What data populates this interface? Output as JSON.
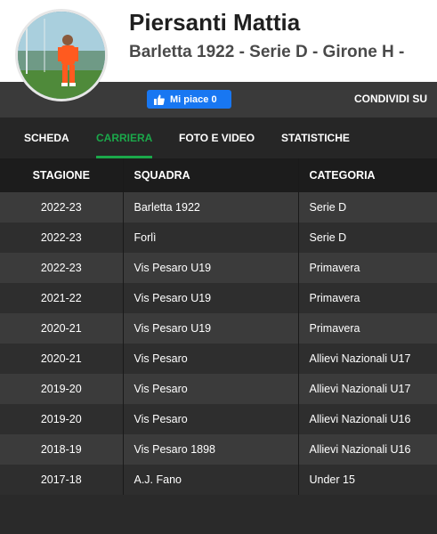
{
  "player": {
    "name": "Piersanti Mattia",
    "subtitle": "Barletta 1922 - Serie D - Girone H -"
  },
  "social": {
    "like_label": "Mi piace 0",
    "share_label": "CONDIVIDI SU",
    "like_color": "#1877f2"
  },
  "tabs": [
    {
      "label": "SCHEDA",
      "active": false
    },
    {
      "label": "CARRIERA",
      "active": true
    },
    {
      "label": "FOTO E VIDEO",
      "active": false
    },
    {
      "label": "STATISTICHE",
      "active": false
    }
  ],
  "accent_color": "#1ba84a",
  "career": {
    "headers": [
      "STAGIONE",
      "SQUADRA",
      "CATEGORIA"
    ],
    "rows": [
      [
        "2022-23",
        "Barletta 1922",
        "Serie D"
      ],
      [
        "2022-23",
        "Forlì",
        "Serie D"
      ],
      [
        "2022-23",
        "Vis Pesaro U19",
        "Primavera"
      ],
      [
        "2021-22",
        "Vis Pesaro U19",
        "Primavera"
      ],
      [
        "2020-21",
        "Vis Pesaro U19",
        "Primavera"
      ],
      [
        "2020-21",
        "Vis Pesaro",
        "Allievi Nazionali U17"
      ],
      [
        "2019-20",
        "Vis Pesaro",
        "Allievi Nazionali U17"
      ],
      [
        "2019-20",
        "Vis Pesaro",
        "Allievi Nazionali U16"
      ],
      [
        "2018-19",
        "Vis Pesaro 1898",
        "Allievi Nazionali U16"
      ],
      [
        "2017-18",
        "A.J. Fano",
        "Under 15"
      ]
    ]
  }
}
